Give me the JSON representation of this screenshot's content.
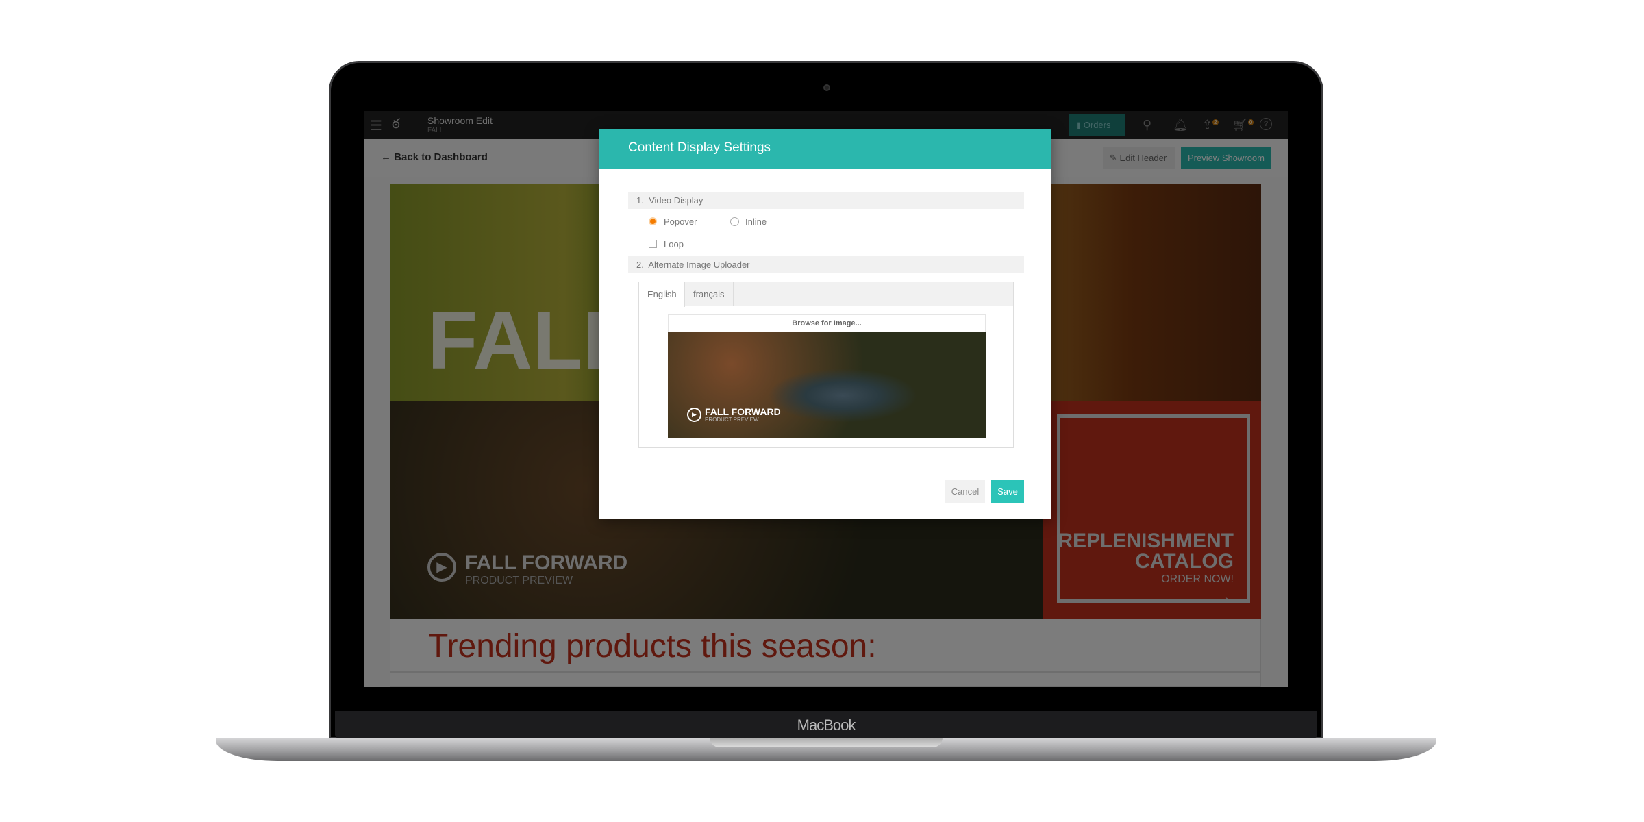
{
  "device": {
    "label": "MacBook"
  },
  "topbar": {
    "title": "Showroom Edit",
    "subtitle": "FALL",
    "orders_label": "Orders",
    "icons": [
      "menu-icon",
      "logo-icon",
      "clipboard-icon",
      "search-icon",
      "bell-icon",
      "share-icon",
      "cart-icon",
      "help-icon"
    ],
    "share_badge": "2",
    "cart_badge": "0"
  },
  "subbar": {
    "back_label": "Back to Dashboard",
    "edit_header_label": "Edit Header",
    "preview_label": "Preview Showroom"
  },
  "content": {
    "fall_text": "FALL",
    "fall_forward_title": "FALL FORWARD",
    "fall_forward_sub": "PRODUCT PREVIEW",
    "catalog_line1": "REPLENISHMENT",
    "catalog_line2": "CATALOG",
    "catalog_cta": "ORDER NOW!",
    "trending": "Trending products this season:"
  },
  "modal": {
    "title": "Content Display Settings",
    "section1": {
      "number": "1.",
      "label": "Video Display",
      "options": [
        {
          "label": "Popover",
          "selected": true
        },
        {
          "label": "Inline",
          "selected": false
        }
      ],
      "loop_label": "Loop",
      "loop_checked": false
    },
    "section2": {
      "number": "2.",
      "label": "Alternate Image Uploader",
      "tabs": [
        {
          "label": "English",
          "active": true
        },
        {
          "label": "français",
          "active": false
        }
      ],
      "browse_label": "Browse for Image...",
      "preview_title": "FALL FORWARD",
      "preview_sub": "PRODUCT PREVIEW"
    },
    "cancel_label": "Cancel",
    "save_label": "Save"
  },
  "colors": {
    "accent": "#2bb7ad",
    "radio": "#f57c00",
    "brand_red": "#c0301c",
    "trending_text": "#c0301c"
  }
}
